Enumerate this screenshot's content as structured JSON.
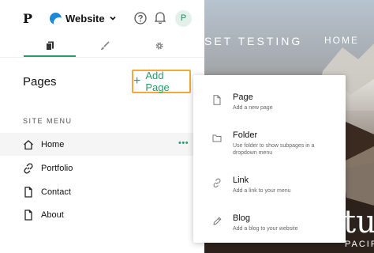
{
  "topbar": {
    "logo": "P",
    "site_name": "Website",
    "avatar_initial": "P"
  },
  "tabs": [
    {
      "icon": "pages-icon",
      "active": true
    },
    {
      "icon": "brush-icon",
      "active": false
    },
    {
      "icon": "gear-icon",
      "active": false
    }
  ],
  "pages": {
    "heading": "Pages",
    "add_button_label": "Add Page",
    "site_menu_label": "SITE MENU",
    "items": [
      {
        "label": "Home",
        "icon": "home-icon"
      },
      {
        "label": "Portfolio",
        "icon": "link-icon"
      },
      {
        "label": "Contact",
        "icon": "page-icon"
      },
      {
        "label": "About",
        "icon": "page-icon"
      }
    ],
    "more_label": "•••"
  },
  "dropdown": {
    "items": [
      {
        "title": "Page",
        "description": "Add a new page",
        "icon": "page-icon"
      },
      {
        "title": "Folder",
        "description": "Use folder to show subpages in a dropdown menu",
        "icon": "folder-icon"
      },
      {
        "title": "Link",
        "description": "Add a link to your menu",
        "icon": "link-icon"
      },
      {
        "title": "Blog",
        "description": "Add a blog to your website",
        "icon": "pencil-icon"
      }
    ]
  },
  "preview": {
    "site_title": "SET TESTING",
    "nav_home": "HOME",
    "hero_text": "tu",
    "hero_sub": "PACIFIC N"
  },
  "colors": {
    "accent": "#2a9a66",
    "highlight_border": "#f2a93b",
    "site_icon": "#1c8ad6"
  }
}
